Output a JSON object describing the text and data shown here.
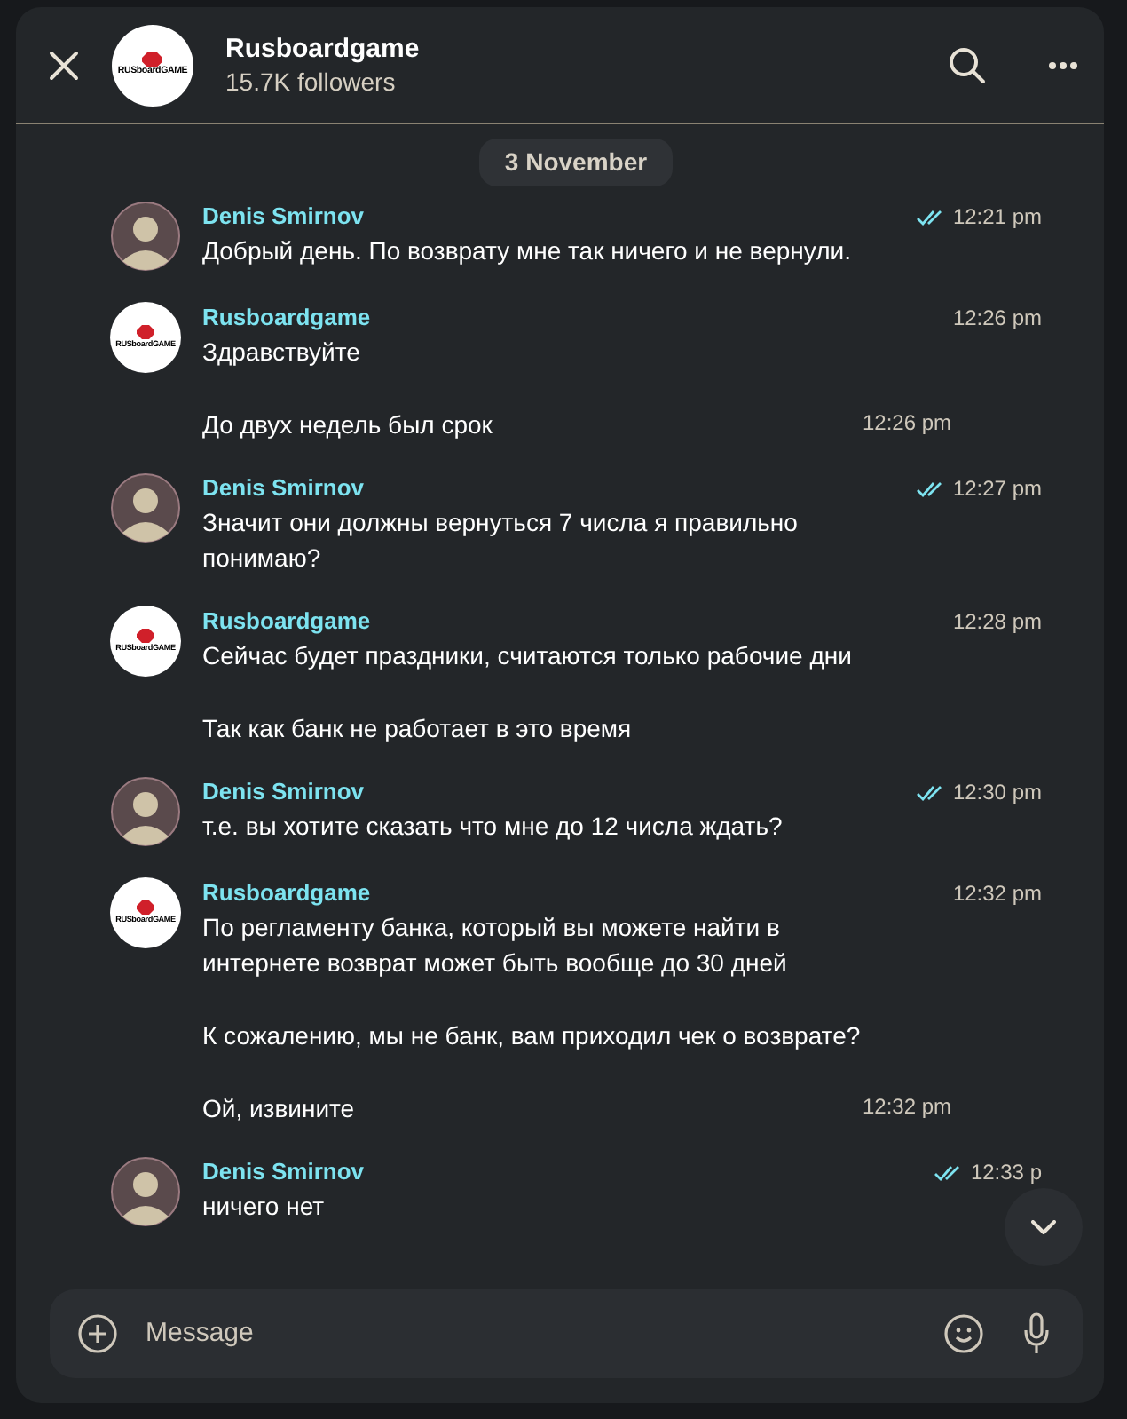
{
  "header": {
    "title": "Rusboardgame",
    "subtitle": "15.7K followers",
    "logo_text": "RUSboardGAME"
  },
  "date_pill": "3 November",
  "groups": [
    {
      "sender": "Denis Smirnov",
      "kind": "user",
      "read": true,
      "time": "12:21 pm",
      "messages": [
        {
          "text": "Добрый день. По возврату мне так ничего и не вернули."
        }
      ]
    },
    {
      "sender": "Rusboardgame",
      "kind": "channel",
      "logo_text": "RUSboardGAME",
      "read": false,
      "time": "12:26 pm",
      "messages": [
        {
          "text": "Здравствуйте"
        },
        {
          "text": "До двух недель был срок",
          "time": "12:26 pm"
        }
      ]
    },
    {
      "sender": "Denis Smirnov",
      "kind": "user",
      "read": true,
      "time": "12:27 pm",
      "messages": [
        {
          "text": "Значит они должны вернуться 7 числа я правильно понимаю?"
        }
      ]
    },
    {
      "sender": "Rusboardgame",
      "kind": "channel",
      "logo_text": "RUSboardGAME",
      "read": false,
      "time": "12:28 pm",
      "messages": [
        {
          "text": "Сейчас будет праздники, считаются только рабочие дни"
        },
        {
          "text": "Так как банк не работает в это время"
        }
      ]
    },
    {
      "sender": "Denis Smirnov",
      "kind": "user",
      "read": true,
      "time": "12:30 pm",
      "messages": [
        {
          "text": "т.е. вы хотите сказать что мне до 12 числа ждать?"
        }
      ]
    },
    {
      "sender": "Rusboardgame",
      "kind": "channel",
      "logo_text": "RUSboardGAME",
      "read": false,
      "time": "12:32 pm",
      "messages": [
        {
          "text": "По регламенту банка, который вы можете найти в интернете возврат может быть вообще до 30 дней"
        },
        {
          "text": "К сожалению, мы не банк, вам приходил чек о возврате?"
        },
        {
          "text": "Ой, извините",
          "time": "12:32 pm"
        }
      ]
    },
    {
      "sender": "Denis Smirnov",
      "kind": "user",
      "read": true,
      "time": "12:33 p",
      "messages": [
        {
          "text": "ничего нет"
        }
      ]
    }
  ],
  "composer": {
    "placeholder": "Message"
  }
}
